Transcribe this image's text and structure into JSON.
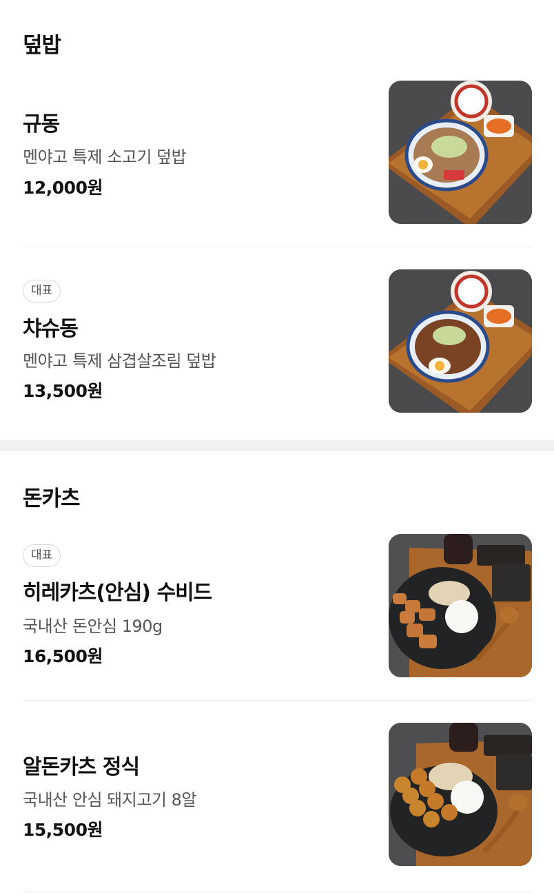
{
  "sections": [
    {
      "title": "덮밥",
      "items": [
        {
          "badge": "",
          "name": "규동",
          "description": "멘야고 특제 소고기 덮밥",
          "price": "12,000원",
          "image_icon": "gyudon-bowl-photo"
        },
        {
          "badge": "대표",
          "name": "챠슈동",
          "description": "멘야고 특제 삼겹살조림 덮밥",
          "price": "13,500원",
          "image_icon": "chashudon-bowl-photo"
        }
      ]
    },
    {
      "title": "돈카츠",
      "items": [
        {
          "badge": "대표",
          "name": "히레카츠(안심) 수비드",
          "description": "국내산 돈안심 190g",
          "price": "16,500원",
          "image_icon": "hirekatsu-plate-photo"
        },
        {
          "badge": "",
          "name": "알돈카츠 정식",
          "description": "국내산 안심 돼지고기 8알",
          "price": "15,500원",
          "image_icon": "aldonkatsu-plate-photo"
        }
      ]
    }
  ],
  "colors": {
    "band": "#f1f1f1",
    "divider": "#ececec",
    "badge_border": "#d6d6d6",
    "text_secondary": "#555555"
  }
}
